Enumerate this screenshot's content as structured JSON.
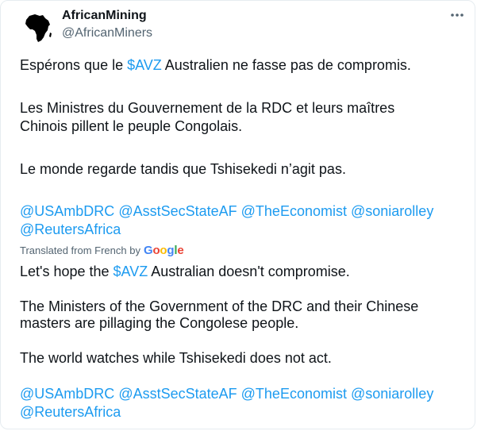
{
  "author": {
    "name": "AfricanMining",
    "handle": "@AfricanMiners"
  },
  "original": {
    "line1_pre": "Espérons que le ",
    "line1_cashtag": "$AVZ",
    "line1_post": " Australien ne fasse pas de compromis.",
    "para2": "Les Ministres du Gouvernement de la RDC et leurs maîtres Chinois pillent le peuple Congolais.",
    "para3": "Le monde regarde tandis que Tshisekedi n’agit pas.",
    "mentions": [
      "@USAmbDRC",
      "@AsstSecStateAF",
      "@TheEconomist",
      "@soniarolley",
      "@ReutersAfrica"
    ]
  },
  "translation_notice": {
    "label": "Translated from French by",
    "provider": "Google"
  },
  "translated": {
    "line1_pre": "Let's hope the ",
    "line1_cashtag": "$AVZ",
    "line1_post": " Australian doesn't compromise.",
    "para2": "The Ministers of the Government of the DRC and their Chinese masters are pillaging the Congolese people.",
    "para3": "The world watches while Tshisekedi does not act.",
    "mentions": [
      "@USAmbDRC",
      "@AsstSecStateAF",
      "@TheEconomist",
      "@soniarolley",
      "@ReutersAfrica"
    ]
  },
  "colors": {
    "link": "#1d9bf0",
    "text": "#0f1419",
    "secondary": "#536471"
  },
  "icons": {
    "avatar": "africa-map-icon",
    "more": "more-options-icon"
  }
}
